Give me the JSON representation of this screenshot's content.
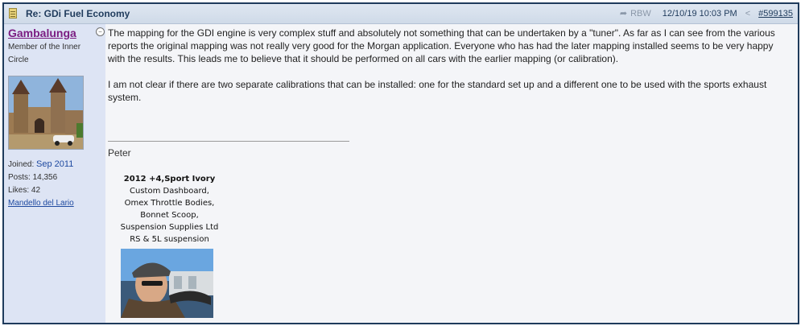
{
  "header": {
    "title": "Re: GDi Fuel Economy",
    "reply_to": "RBW",
    "datetime": "12/10/19 10:03 PM",
    "post_number": "#599135"
  },
  "user": {
    "name": "Gambalunga",
    "title": "Member of the Inner Circle",
    "joined_label": "Joined:",
    "joined_value": "Sep 2011",
    "posts_label": "Posts:",
    "posts_value": "14,356",
    "likes_label": "Likes:",
    "likes_value": "42",
    "location": "Mandello del Lario"
  },
  "post": {
    "paragraph_1": "The mapping for the GDI engine is very complex stuff and absolutely not something that can be undertaken by a \"tuner\". As far as I can see from the various reports the original mapping was not really very good for the Morgan application. Everyone who has had the later mapping installed seems to be very happy with the results. This leads me to believe that it should be performed on all cars with the earlier mapping (or calibration).",
    "paragraph_2": "I am not clear if there are two separate calibrations that can be installed: one for the standard set up and a different one to be used with the sports exhaust system."
  },
  "signature": {
    "name": "Peter",
    "line_1": "2012 +4,Sport Ivory",
    "line_2": "Custom Dashboard,",
    "line_3": "Omex Throttle Bodies,",
    "line_4": "Bonnet Scoop,",
    "line_5": "Suspension Supplies Ltd",
    "line_6": "RS & 5L suspension"
  },
  "colors": {
    "frame_border": "#1f3b5c",
    "header_bg": "#cfdae8",
    "sidebar_bg": "#dde4f4",
    "username": "#7b1d82",
    "link": "#1f4aa0"
  },
  "icons": {
    "topic": "topic-icon",
    "reply": "reply-arrow-icon",
    "share": "share-icon",
    "status": "offline-status-icon"
  }
}
